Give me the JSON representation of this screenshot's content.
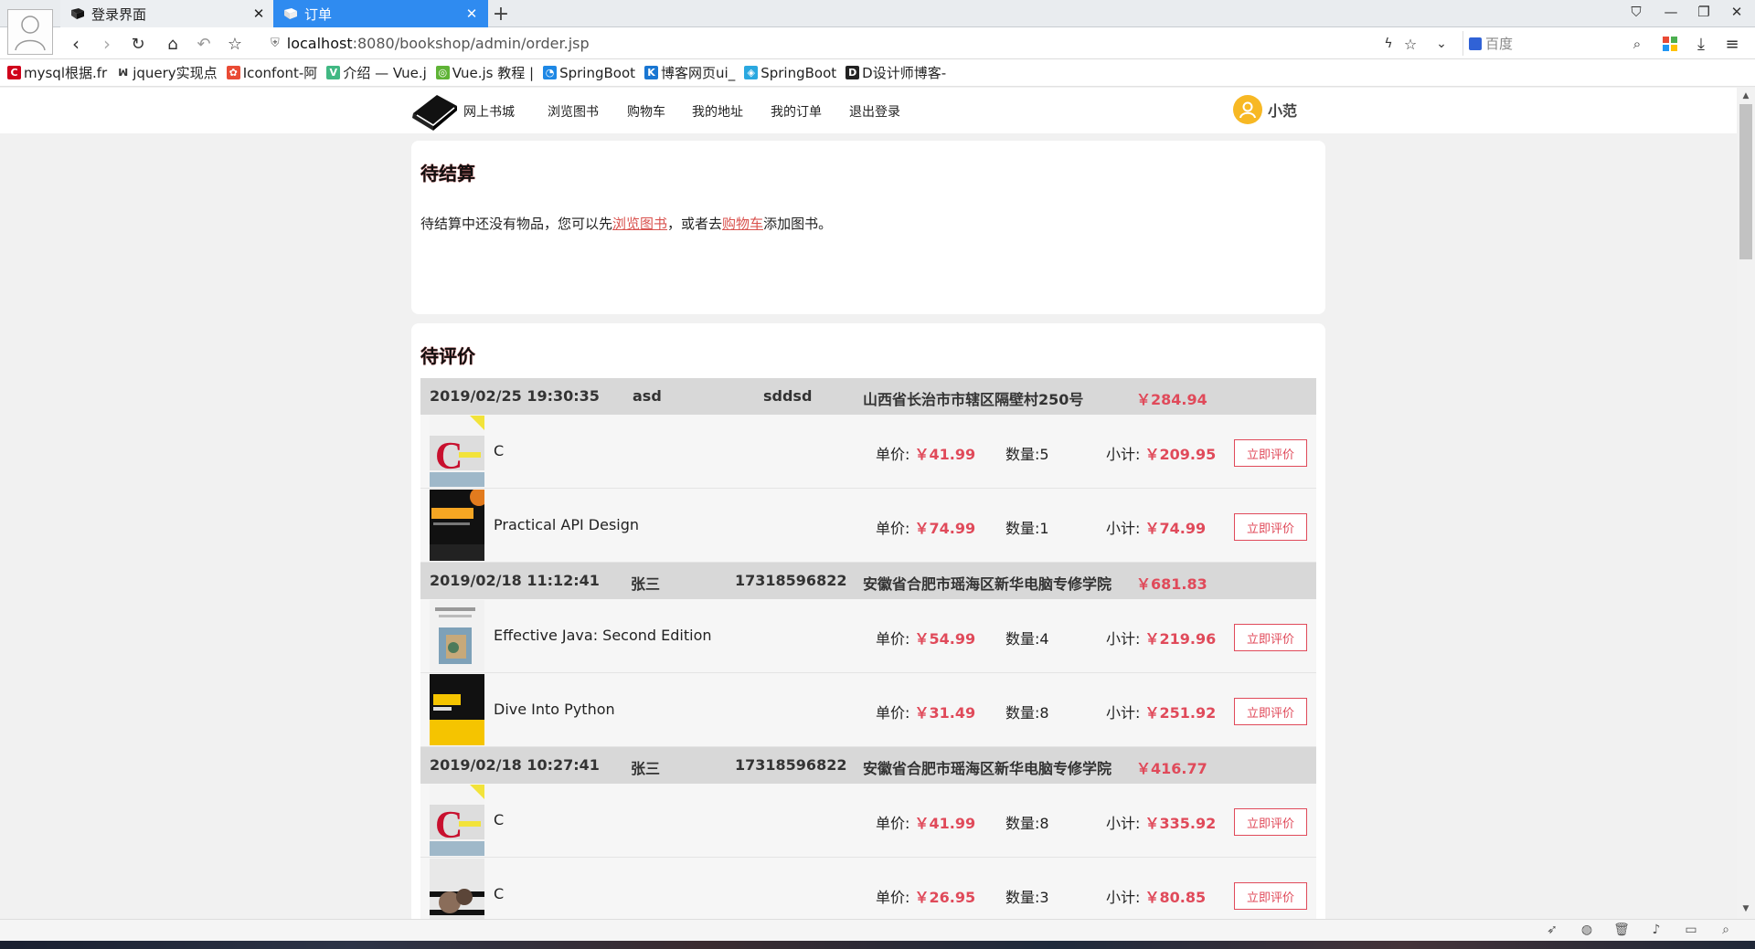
{
  "browser": {
    "tabs": [
      {
        "label": "登录界面",
        "active": false
      },
      {
        "label": "订单",
        "active": true
      }
    ],
    "new_tab": "+",
    "url": {
      "host": "localhost",
      "rest": ":8080/bookshop/admin/order.jsp"
    },
    "search_placeholder": "百度",
    "bookmarks": [
      {
        "label": "mysql根据.fr",
        "color": "#d0021b",
        "glyph": "C"
      },
      {
        "label": "jquery实现点",
        "color": "#ffffff",
        "glyph": "ꟽ"
      },
      {
        "label": "Iconfont-阿",
        "color": "#e94b35",
        "glyph": "✿"
      },
      {
        "label": "介绍 — Vue.j",
        "color": "#41b883",
        "glyph": "V"
      },
      {
        "label": "Vue.js 教程 |",
        "color": "#5fb336",
        "glyph": "◎"
      },
      {
        "label": "SpringBoot",
        "color": "#1e88e5",
        "glyph": "◔"
      },
      {
        "label": "博客网页ui_",
        "color": "#1976d2",
        "glyph": "K"
      },
      {
        "label": "SpringBoot",
        "color": "#2aa8e0",
        "glyph": "◈"
      },
      {
        "label": "D设计师博客-",
        "color": "#222222",
        "glyph": "D"
      }
    ]
  },
  "nav": {
    "brand": "网上书城",
    "items": [
      "浏览图书",
      "购物车",
      "我的地址",
      "我的订单",
      "退出登录"
    ],
    "username": "小范"
  },
  "pending": {
    "title": "待结算",
    "msg_before": "待结算中还没有物品，您可以先",
    "link_browse": "浏览图书",
    "msg_middle": "，或者去",
    "link_cart": "购物车",
    "msg_after": "添加图书。"
  },
  "review": {
    "title": "待评价",
    "labels": {
      "price": "单价:",
      "qty": "数量:",
      "subtotal": "小计:",
      "button": "立即评价"
    },
    "orders": [
      {
        "date": "2019/02/25 19:30:35",
        "name": "asd",
        "phone": "sddsd",
        "address": "山西省长治市市辖区隔壁村250号",
        "total": "￥284.94",
        "items": [
          {
            "title": "C",
            "price": "￥41.99",
            "qty": "5",
            "subtotal": "￥209.95",
            "cover": "c-complete"
          },
          {
            "title": "Practical API Design",
            "price": "￥74.99",
            "qty": "1",
            "subtotal": "￥74.99",
            "cover": "api-design"
          }
        ]
      },
      {
        "date": "2019/02/18 11:12:41",
        "name": "张三",
        "phone": "17318596822",
        "address": "安徽省合肥市瑶海区新华电脑专修学院",
        "total": "￥681.83",
        "items": [
          {
            "title": "Effective Java: Second Edition",
            "price": "￥54.99",
            "qty": "4",
            "subtotal": "￥219.96",
            "cover": "effective-java"
          },
          {
            "title": "Dive Into Python",
            "price": "￥31.49",
            "qty": "8",
            "subtotal": "￥251.92",
            "cover": "dive-python"
          }
        ]
      },
      {
        "date": "2019/02/18 10:27:41",
        "name": "张三",
        "phone": "17318596822",
        "address": "安徽省合肥市瑶海区新华电脑专修学院",
        "total": "￥416.77",
        "items": [
          {
            "title": "C",
            "price": "￥41.99",
            "qty": "8",
            "subtotal": "￥335.92",
            "cover": "c-complete"
          },
          {
            "title": "C",
            "price": "￥26.95",
            "qty": "3",
            "subtotal": "￥80.85",
            "cover": "c-dark"
          }
        ]
      }
    ]
  },
  "colors": {
    "accent": "#e04a5a",
    "tab_active": "#2f8bf0",
    "header_gray": "#d8d8d8"
  }
}
